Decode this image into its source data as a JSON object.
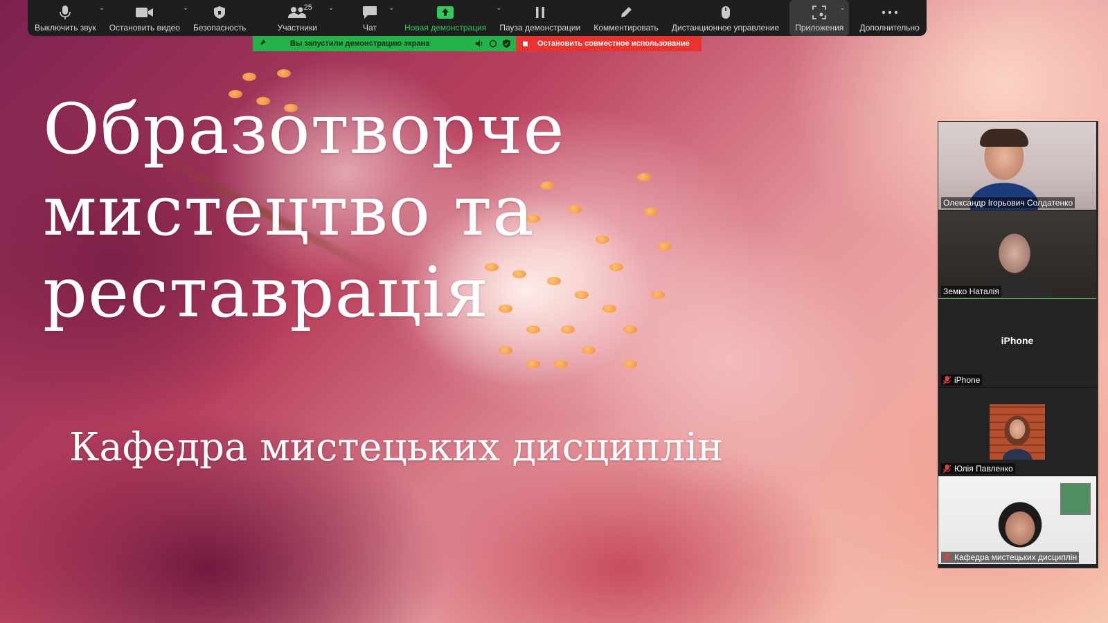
{
  "toolbar": {
    "mute": "Выключить звук",
    "stop_video": "Остановить видео",
    "security": "Безопасность",
    "participants": "Участники",
    "participants_count": "25",
    "chat": "Чат",
    "new_share": "Новая демонстрация",
    "pause_share": "Пауза демонстрации",
    "annotate": "Комментировать",
    "remote_control": "Дистанционное управление",
    "apps": "Приложения",
    "more": "Дополнительно"
  },
  "share_banner": {
    "status": "Вы запустили демонстрацию экрана",
    "stop": "Остановить совместное использование"
  },
  "slide": {
    "title_line1": "Образотворче",
    "title_line2": "мистецтво та",
    "title_line3": "реставрація",
    "subtitle": "Кафедра мистецьких дисциплін"
  },
  "participants": [
    {
      "name": "Олександр Ігорьович Солдатенко"
    },
    {
      "name": "Земко Наталія"
    },
    {
      "name": "iPhone",
      "placeholder": "iPhone"
    },
    {
      "name": "Юлія Павленко"
    },
    {
      "name": "Кафедра мистецьких дисциплін"
    }
  ],
  "colors": {
    "toolbar_bg": "#1e1e1e",
    "share_green": "#23b34a",
    "stop_red": "#e8332e",
    "speaking_outline": "#6fd16a"
  }
}
